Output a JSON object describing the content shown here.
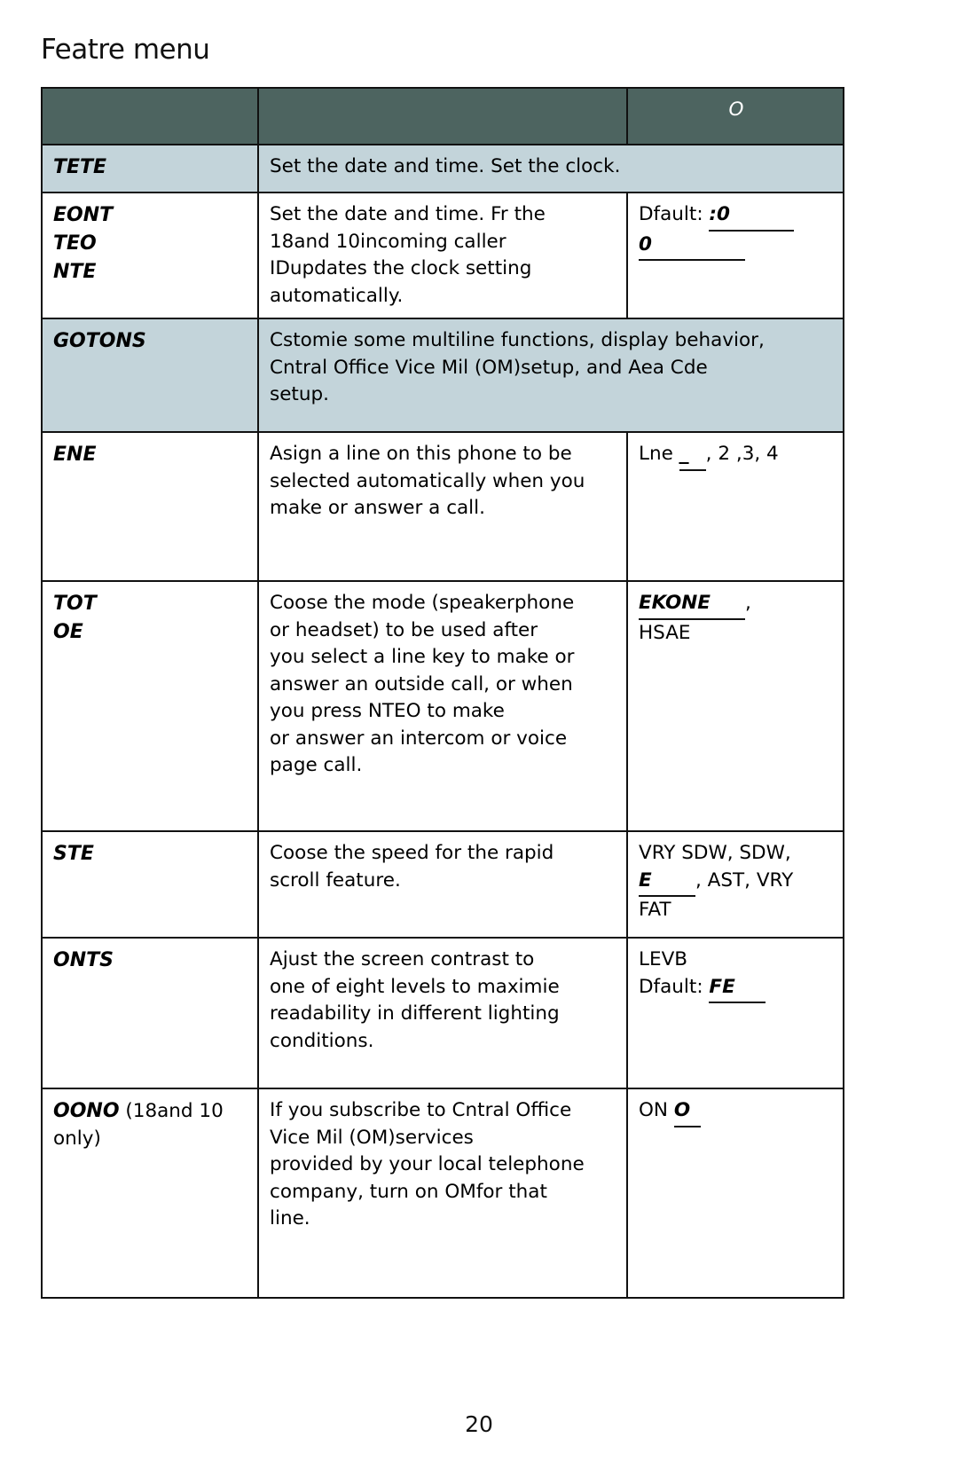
{
  "document": {
    "title": "Featre menu",
    "page_number": "20"
  },
  "table": {
    "header": {
      "col1": "",
      "col2": "",
      "col3": "O"
    },
    "rows": [
      {
        "name": "TETE",
        "name_sub": "",
        "description": "Set the date and time. Set the clock.",
        "options_pre": "",
        "options_underline1": "",
        "options_mid": "",
        "options_underline2": "",
        "options_post": "",
        "shaded": true,
        "spans_two": true
      },
      {
        "name": "EONT\nTEO\nNTE",
        "name_sub": "",
        "description": "Set the date and time.  Fr the\n18and 10incoming caller\nIDupdates the clock setting\nautomatically.",
        "options_pre": "Dfault:  ",
        "options_underline1": ":0",
        "options_mid": "\n",
        "options_underline2": "0",
        "options_post": "",
        "shaded": false,
        "spans_two": false
      },
      {
        "name": "GOTONS",
        "name_sub": "",
        "description": "Cstomie some multiline functions, display behavior,\nCntral Office Vice Mil (OM)setup, and Aea Cde\nsetup.",
        "options_pre": "",
        "options_underline1": "",
        "options_mid": "",
        "options_underline2": "",
        "options_post": "",
        "shaded": true,
        "spans_two": true
      },
      {
        "name": "ENE",
        "name_sub": "",
        "description": "Asign a line on this phone to be\nselected automatically when you\nmake or answer a call.",
        "options_pre": "Lne   ",
        "options_underline1": "_",
        "options_mid": ", 2 ,3, 4",
        "options_underline2": "",
        "options_post": "",
        "shaded": false,
        "spans_two": false
      },
      {
        "name": "TOT\nOE",
        "name_sub": "",
        "description_part1": "Coose the mode (speakerphone\nor headset) to be used after\nyou select a line key to make or\nanswer an outside call, or when\nyou press ",
        "description_bold": "NTEO",
        "description_part2": "          to make\nor answer an intercom or voice\npage call.",
        "options_pre": "",
        "options_underline1": "EKONE",
        "options_mid": ",\nHSAE",
        "options_underline2": "",
        "options_post": "",
        "shaded": false,
        "spans_two": false
      },
      {
        "name": "STE",
        "name_sub": "",
        "description": "Coose the speed for the rapid\nscroll feature.",
        "options_pre": "VRY SDW, SDW,\n",
        "options_underline1": "E",
        "options_mid": ", AST, VRY\nFAT",
        "options_underline2": "",
        "options_post": "",
        "shaded": false,
        "spans_two": false
      },
      {
        "name": "ONTS",
        "name_sub": "",
        "description": "Ajust the screen contrast to\none of eight levels to maximie\nreadability in different lighting\nconditions.",
        "options_pre": "LEVB\nDfault:  ",
        "options_underline1": "FE",
        "options_mid": "",
        "options_underline2": "",
        "options_post": "",
        "shaded": false,
        "spans_two": false
      },
      {
        "name": "OONO",
        "name_sub": "(18and 10\nonly)",
        "description": "If you subscribe to Cntral Office\nVice Mil (OM)services\nprovided by your local telephone\ncompany, turn on OMfor that\nline.",
        "options_pre": "ON  ",
        "options_underline1": "O",
        "options_mid": "",
        "options_underline2": "",
        "options_post": "",
        "shaded": false,
        "spans_two": false
      }
    ]
  },
  "colors": {
    "header_bg": "#4d6460",
    "shaded_row_bg": "#c3d4da",
    "border": "#111111",
    "text": "#000000",
    "header_text": "#ffffff"
  }
}
